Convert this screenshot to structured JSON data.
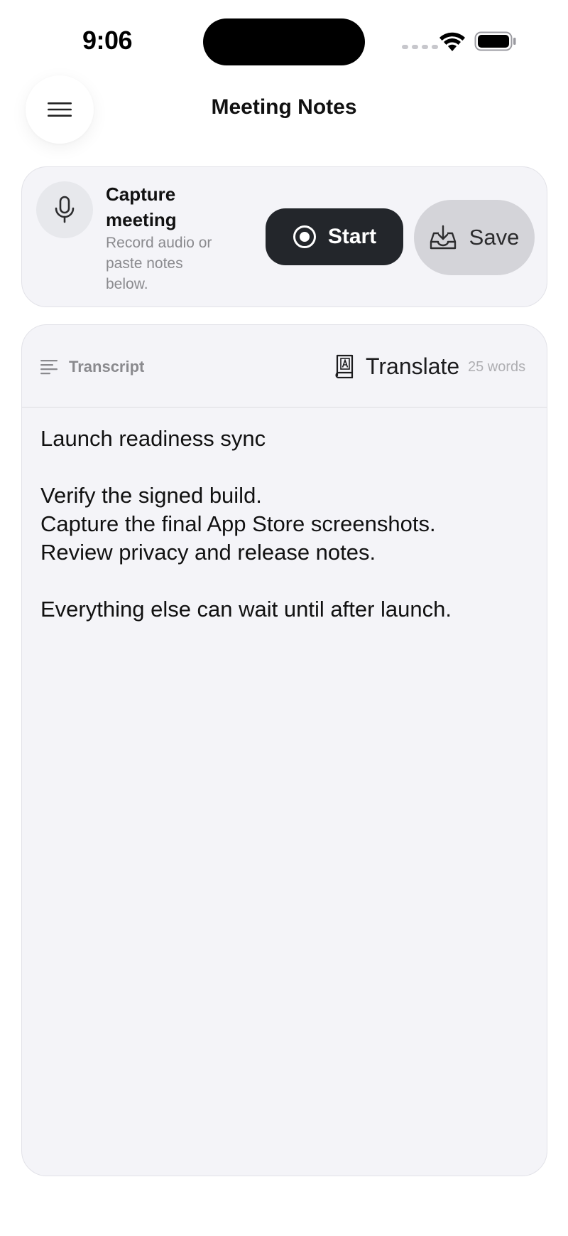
{
  "status_bar": {
    "time": "9:06",
    "icons": [
      "cellular-dots-icon",
      "wifi-icon",
      "battery-icon"
    ]
  },
  "header": {
    "title": "Meeting Notes",
    "menu_icon": "hamburger-icon"
  },
  "capture": {
    "icon": "microphone-icon",
    "title": "Capture meeting",
    "subtitle": "Record audio or paste notes below.",
    "start_label": "Start",
    "start_icon": "record-icon",
    "save_label": "Save",
    "save_icon": "inbox-download-icon"
  },
  "transcript": {
    "label": "Transcript",
    "label_icon": "text-lines-icon",
    "translate_label": "Translate",
    "translate_icon": "book-translate-icon",
    "word_count": "25 words",
    "lines": [
      "Launch readiness sync",
      "",
      "Verify the signed build.",
      "Capture the final App Store screenshots.",
      "Review privacy and release notes.",
      "",
      "Everything else can wait until after launch."
    ]
  },
  "colors": {
    "primary_button": "#23262b",
    "secondary_button": "#d4d4d9",
    "card_background": "#f4f4f8",
    "muted_text": "#8a8a8e"
  }
}
